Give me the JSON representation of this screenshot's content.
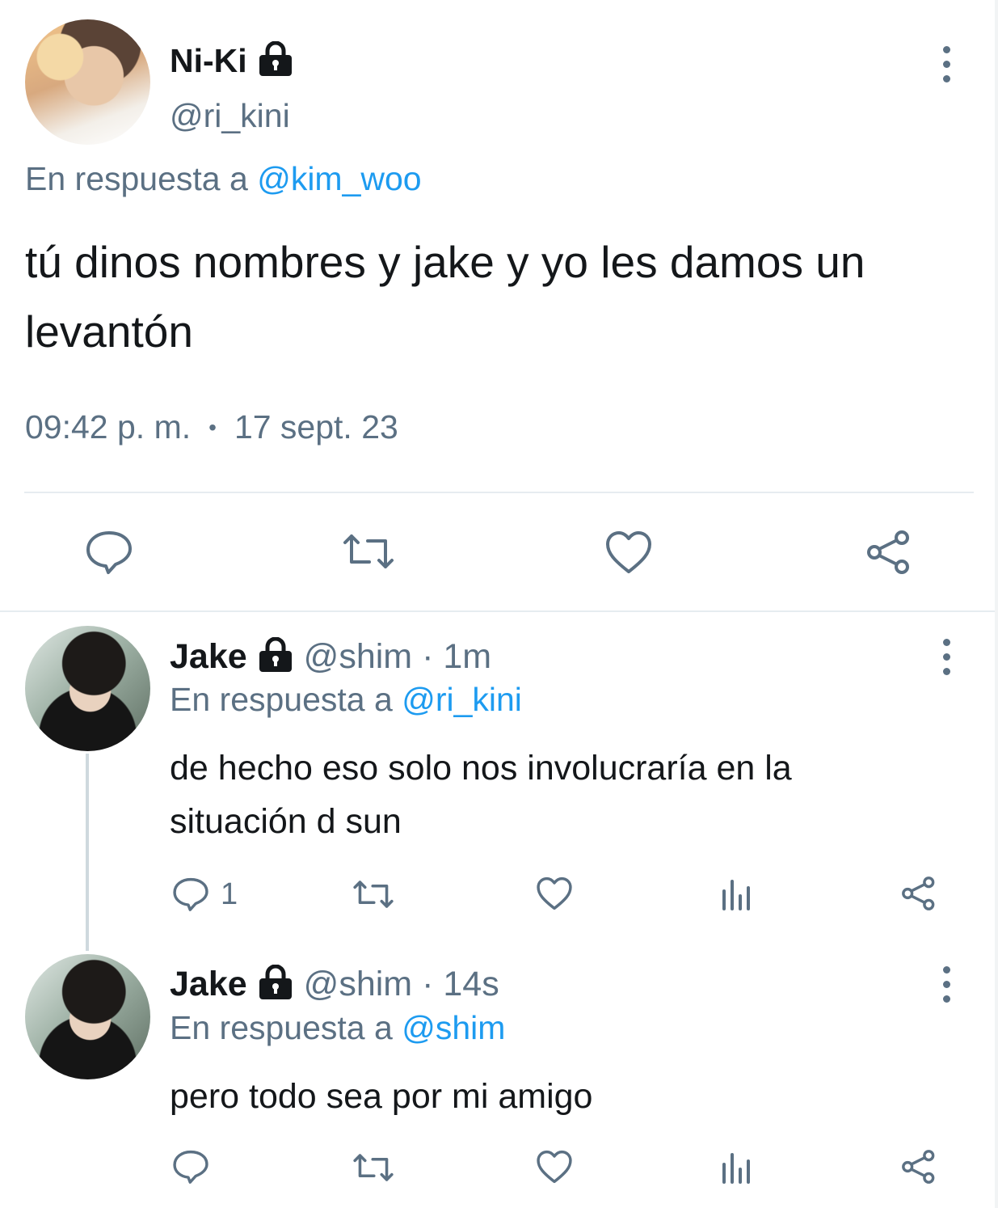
{
  "main_tweet": {
    "display_name": "Ni-Ki",
    "handle": "@ri_kini",
    "reply_prefix": "En respuesta a",
    "reply_to": "@kim_woo",
    "text_line1": "tú dinos nombres y jake y yo les damos un",
    "text_line2": "levantón",
    "time": "09:42 p. m.",
    "separator": "•",
    "date": "17 sept. 23"
  },
  "replies": [
    {
      "display_name": "Jake",
      "handle": "@shim",
      "age": "· 1m",
      "reply_prefix": "En respuesta a",
      "reply_to": "@ri_kini",
      "text_line1": "de hecho eso solo nos involucraría en la",
      "text_line2": "situación d sun",
      "reply_count": "1"
    },
    {
      "display_name": "Jake",
      "handle": "@shim",
      "age": "· 14s",
      "reply_prefix": "En respuesta a",
      "reply_to": "@shim",
      "text_line1": "pero todo sea por mi amigo",
      "reply_count": ""
    }
  ],
  "icons": {
    "lock": "lock-icon",
    "more": "more-vertical-icon",
    "reply": "reply-icon",
    "retweet": "retweet-icon",
    "like": "heart-icon",
    "analytics": "analytics-icon",
    "share": "share-icon"
  },
  "colors": {
    "link": "#1d9bf0",
    "muted": "#5b7083",
    "text": "#14171a"
  }
}
